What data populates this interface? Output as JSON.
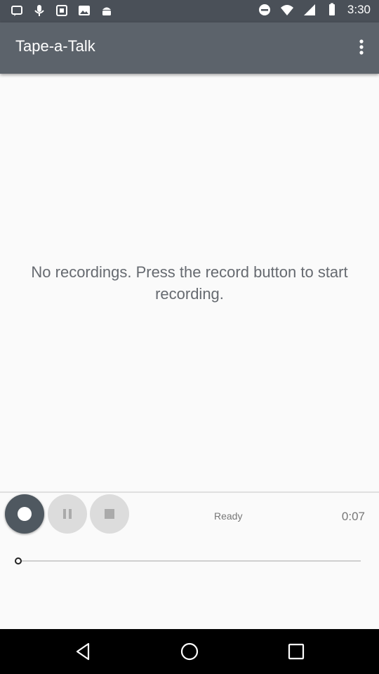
{
  "status_bar": {
    "time": "3:30",
    "icons": [
      "notification-icon",
      "mic-icon",
      "screenshot-icon",
      "photo-icon",
      "android-icon",
      "do-not-disturb-icon",
      "wifi-icon",
      "signal-icon",
      "battery-icon"
    ]
  },
  "toolbar": {
    "title": "Tape-a-Talk",
    "menu_icon": "overflow-menu-icon"
  },
  "main": {
    "empty_message": "No recordings. Press the record button to start recording."
  },
  "player": {
    "status": "Ready",
    "elapsed": "0:07",
    "progress": 0,
    "buttons": [
      "record",
      "pause",
      "stop"
    ]
  },
  "nav": {
    "buttons": [
      "back",
      "home",
      "recents"
    ]
  },
  "colors": {
    "toolbar": "#5c636b",
    "status_bar": "#4a5058",
    "record_button": "#4f5860",
    "inactive_button": "#dcdcdc",
    "background": "#fafafa"
  }
}
